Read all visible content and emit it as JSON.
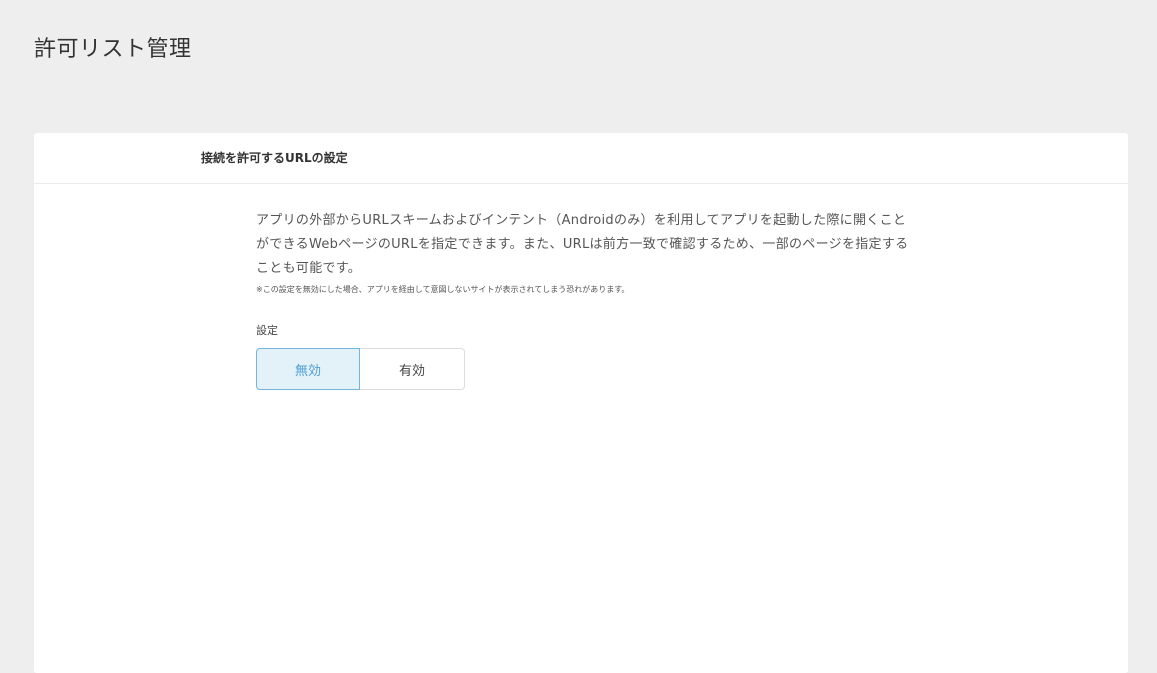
{
  "page": {
    "title": "許可リスト管理"
  },
  "section": {
    "title": "接続を許可するURLの設定",
    "description": "アプリの外部からURLスキームおよびインテント（Androidのみ）を利用してアプリを起動した際に開くことができるWebページのURLを指定できます。また、URLは前方一致で確認するため、一部のページを指定することも可能です。",
    "note": "※この設定を無効にした場合、アプリを経由して意図しないサイトが表示されてしまう恐れがあります。",
    "setting_label": "設定",
    "toggle": {
      "options": [
        {
          "label": "無効",
          "selected": true
        },
        {
          "label": "有効",
          "selected": false
        }
      ]
    }
  },
  "colors": {
    "page_background": "#eeeeee",
    "card_background": "#ffffff",
    "accent": "#4d9fd4",
    "selected_background": "#e3f1f9"
  }
}
